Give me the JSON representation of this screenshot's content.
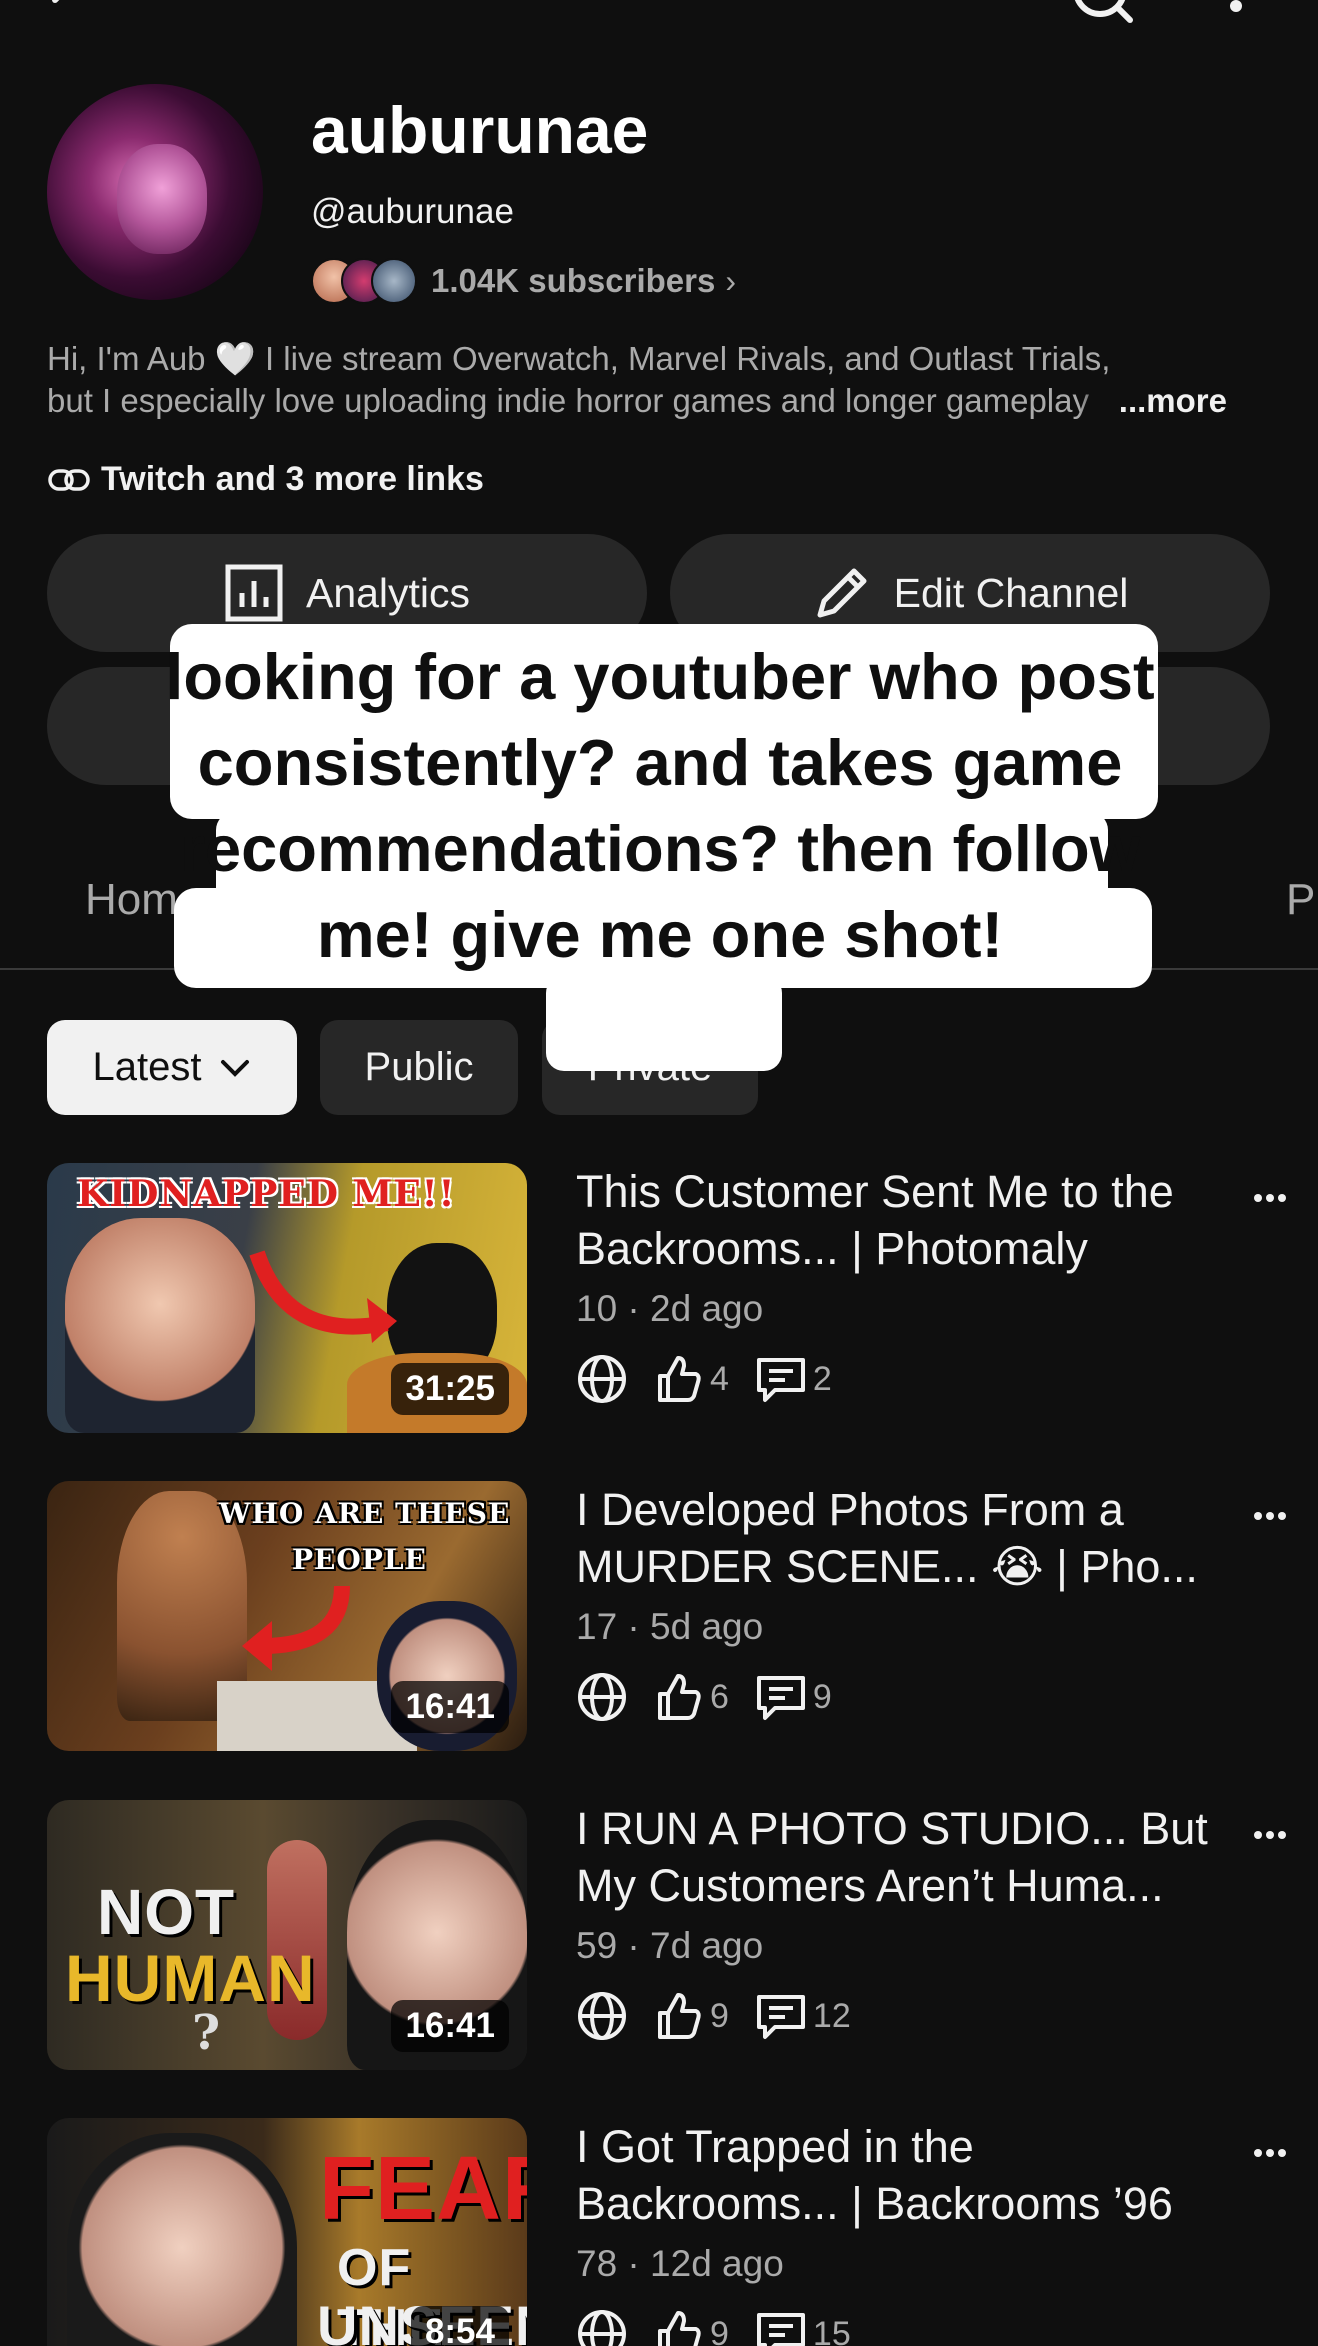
{
  "channel": {
    "name": "auburunae",
    "handle": "@auburunae",
    "subscribers": "1.04K subscribers",
    "description_line1": "Hi, I'm Aub 🤍 I live stream Overwatch, Marvel Rivals, and Outlast Trials,",
    "description_line2": "but I especially love uploading indie horror games and longer gameplay",
    "more_label": "...more",
    "links_label": "Twitch and 3 more links"
  },
  "buttons": {
    "analytics": "Analytics",
    "edit_channel": "Edit Channel"
  },
  "tabs": {
    "home": "Hom",
    "partial_right": "P"
  },
  "filters": {
    "latest": "Latest",
    "public": "Public",
    "private": "Private"
  },
  "caption": "looking for a youtuber who post consistently? and takes game recommendations? then follow me! give me one shot!",
  "videos": [
    {
      "title": "This Customer Sent Me to the Backrooms... | Photomaly",
      "meta": "10 · 2d ago",
      "likes": "4",
      "comments": "2",
      "duration": "31:25",
      "thumb_text": "KIDNAPPED ME!!"
    },
    {
      "title": "I Developed Photos From a MURDER SCENE... 😭 | Pho...",
      "meta": "17 · 5d ago",
      "likes": "6",
      "comments": "9",
      "duration": "16:41",
      "thumb_text_1": "WHO ARE THESE",
      "thumb_text_2": "PEOPLE"
    },
    {
      "title": "I RUN A PHOTO STUDIO... But My Customers Aren’t Huma...",
      "meta": "59 · 7d ago",
      "likes": "9",
      "comments": "12",
      "duration": "16:41",
      "thumb_text_1": "NOT",
      "thumb_text_2": "HUMAN",
      "thumb_text_3": "?"
    },
    {
      "title": "I Got Trapped in the Backrooms... | Backrooms ’96",
      "meta": "78 · 12d ago",
      "likes": "9",
      "comments": "15",
      "duration": "8:54",
      "thumb_text_1": "FEAR",
      "thumb_text_2": "OF THE",
      "thumb_text_3": "UNSEEN"
    }
  ],
  "colors": {
    "background": "#0f0f0f",
    "chip": "#272727",
    "secondary_text": "#aaaaaa"
  }
}
